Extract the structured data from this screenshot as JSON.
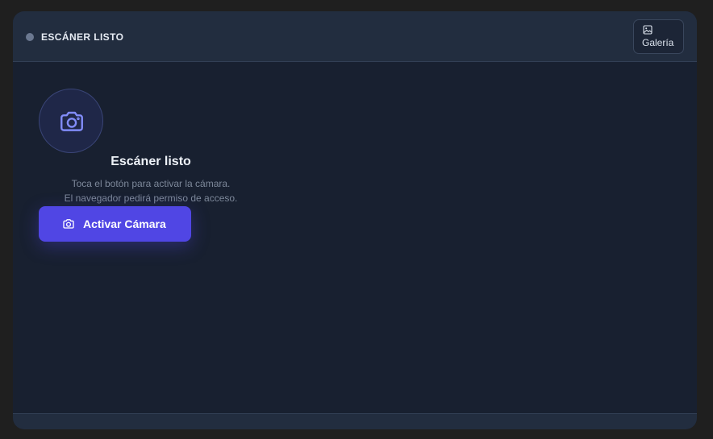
{
  "header": {
    "status_label": "ESCÁNER LISTO",
    "gallery_label": "Galería"
  },
  "scanner": {
    "title": "Escáner listo",
    "hint_line_1": "Toca el botón para activar la cámara.",
    "hint_line_2": "El navegador pedirá permiso de acceso.",
    "activate_label": "Activar Cámara"
  },
  "icons": {
    "status": "status-dot",
    "gallery": "image-icon",
    "camera": "camera-icon",
    "activate": "camera-icon"
  },
  "colors": {
    "accent": "#5046e4",
    "panel_bg": "#182030",
    "header_bg": "#222d3f",
    "status_dot": "#6b7890",
    "camera_icon": "#818cf8"
  }
}
